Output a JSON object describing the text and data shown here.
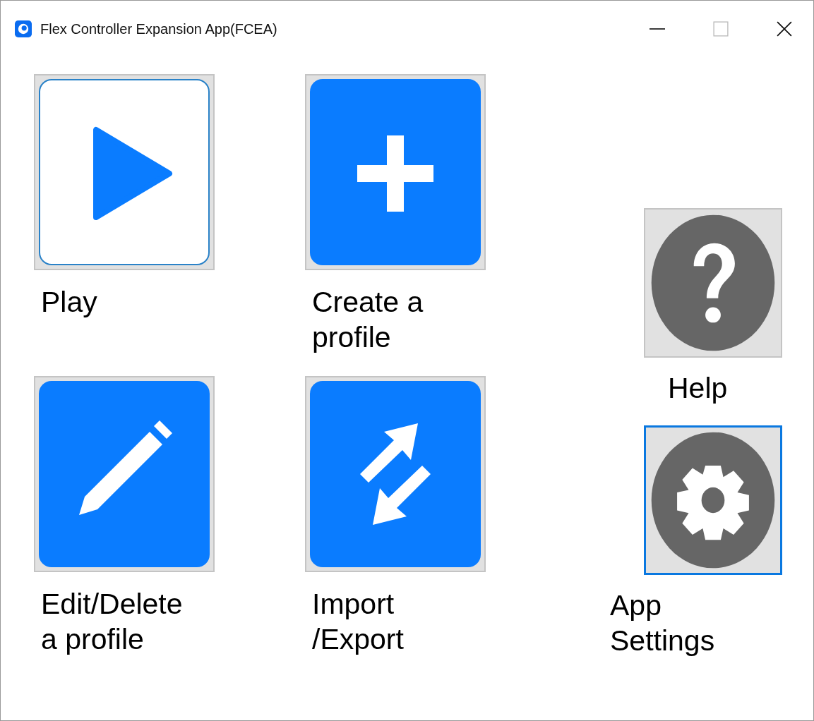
{
  "window": {
    "title": "Flex Controller Expansion App(FCEA)"
  },
  "tiles": [
    {
      "kind": "play",
      "label": "Play",
      "hovered": true,
      "focused": false
    },
    {
      "kind": "create",
      "label": "Create a\nprofile",
      "hovered": false,
      "focused": false
    },
    {
      "kind": "edit",
      "label": "Edit/Delete\na profile",
      "hovered": false,
      "focused": false
    },
    {
      "kind": "transfer",
      "label": "Import\n/Export",
      "hovered": false,
      "focused": false
    }
  ],
  "side_tiles": [
    {
      "kind": "help",
      "label": "Help",
      "focused": false
    },
    {
      "kind": "settings",
      "label": "App\nSettings",
      "focused": true
    }
  ]
}
